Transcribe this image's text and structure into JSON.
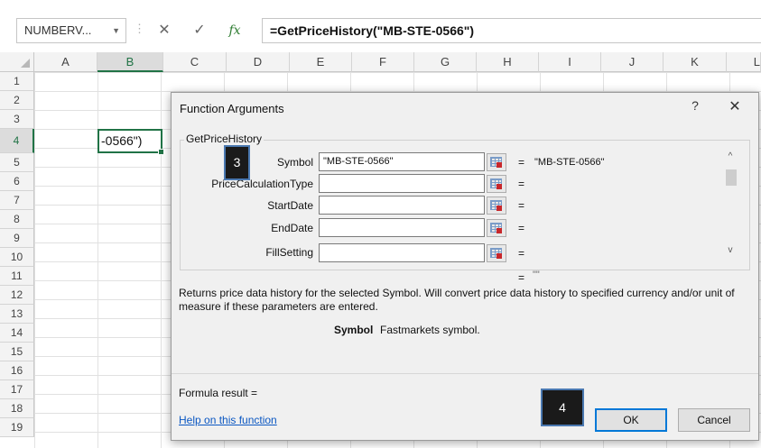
{
  "formula_bar": {
    "name_box": "NUMBERV...",
    "name_box_dropdown": "▼",
    "separator": "⋮",
    "cancel_glyph": "✕",
    "enter_glyph": "✓",
    "fx_glyph": "fx",
    "formula": "=GetPriceHistory(\"MB-STE-0566\")"
  },
  "grid": {
    "columns": [
      "A",
      "B",
      "C",
      "D",
      "E",
      "F",
      "G",
      "H",
      "I",
      "J",
      "K",
      "L"
    ],
    "rows": [
      "1",
      "2",
      "3",
      "4",
      "5",
      "6",
      "7",
      "8",
      "9",
      "10",
      "11",
      "12",
      "13",
      "14",
      "15",
      "16",
      "17",
      "18",
      "19"
    ],
    "active_cell_text": "-0566\")"
  },
  "dialog": {
    "title": "Function Arguments",
    "help_glyph": "?",
    "close_glyph": "✕",
    "function_name": "GetPriceHistory",
    "arguments": [
      {
        "label": "Symbol",
        "value": "\"MB-STE-0566\"",
        "result": "\"MB-STE-0566\""
      },
      {
        "label": "PriceCalculationType",
        "value": "",
        "result": ""
      },
      {
        "label": "StartDate",
        "value": "",
        "result": ""
      },
      {
        "label": "EndDate",
        "value": "",
        "result": ""
      },
      {
        "label": "FillSetting",
        "value": "",
        "result": ""
      }
    ],
    "eq_sign": "=",
    "overall_result": "\"\"",
    "description": "Returns price data history for the selected Symbol. Will convert price data history to specified currency and/or unit of measure if these parameters are entered.",
    "arg_desc_name": "Symbol",
    "arg_desc_text": "Fastmarkets symbol.",
    "formula_result_label": "Formula result =",
    "help_link": "Help on this function",
    "ok_label": "OK",
    "cancel_label": "Cancel",
    "scroll_up": "^",
    "scroll_down": "v"
  },
  "markers": {
    "m3": "3",
    "m4": "4"
  },
  "colors": {
    "excel_green": "#217346",
    "focus_blue": "#0078d7",
    "link_blue": "#0b57c2"
  }
}
